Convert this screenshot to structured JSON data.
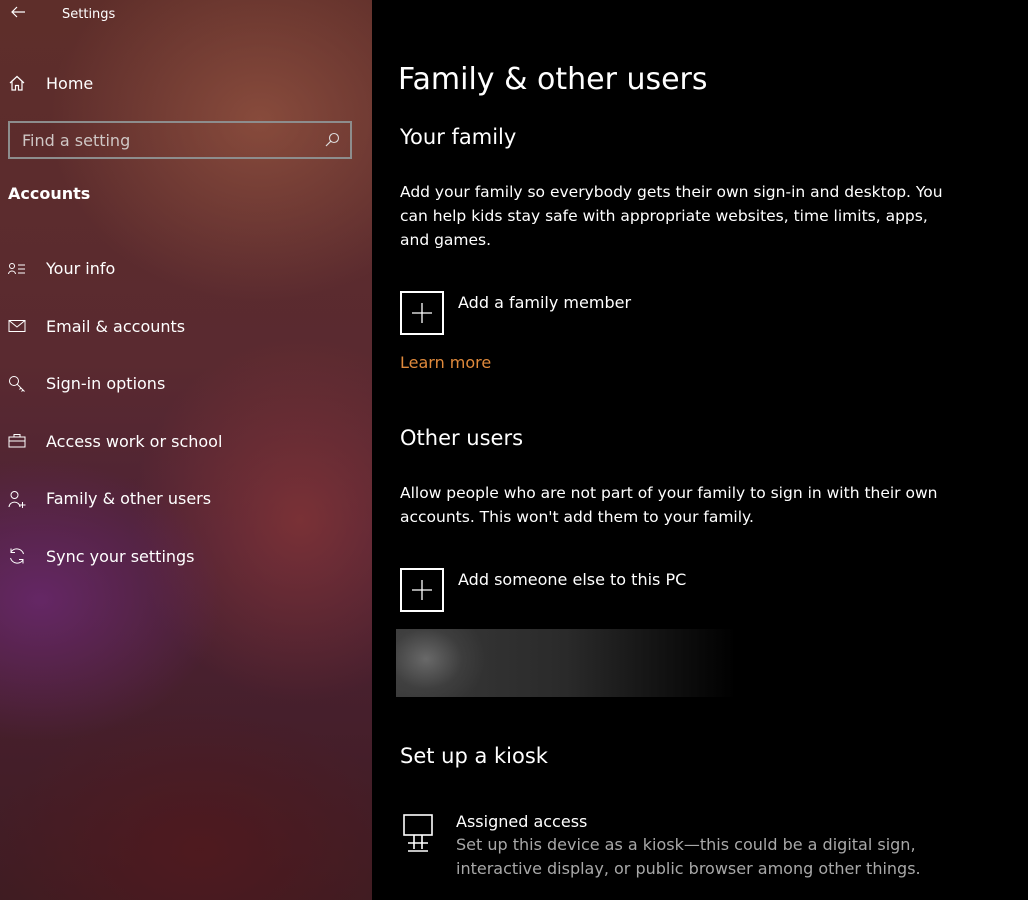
{
  "window": {
    "title": "Settings"
  },
  "sidebar": {
    "home_label": "Home",
    "search_placeholder": "Find a setting",
    "section": "Accounts",
    "items": [
      {
        "label": "Your info",
        "icon": "contact-info-icon"
      },
      {
        "label": "Email & accounts",
        "icon": "mail-icon"
      },
      {
        "label": "Sign-in options",
        "icon": "key-icon"
      },
      {
        "label": "Access work or school",
        "icon": "briefcase-icon"
      },
      {
        "label": "Family & other users",
        "icon": "add-person-icon"
      },
      {
        "label": "Sync your settings",
        "icon": "sync-icon"
      }
    ]
  },
  "main": {
    "title": "Family & other users",
    "family": {
      "heading": "Your family",
      "description": "Add your family so everybody gets their own sign-in and desktop. You can help kids stay safe with appropriate websites, time limits, apps, and games.",
      "add_label": "Add a family member",
      "learn_more": "Learn more"
    },
    "other_users": {
      "heading": "Other users",
      "description": "Allow people who are not part of your family to sign in with their own accounts. This won't add them to your family.",
      "add_label": "Add someone else to this PC"
    },
    "kiosk": {
      "heading": "Set up a kiosk",
      "title": "Assigned access",
      "description": "Set up this device as a kiosk—this could be a digital sign, interactive display, or public browser among other things."
    }
  },
  "colors": {
    "accent_link": "#e08a3c",
    "background": "#000000",
    "secondary_text": "#a8a8a8"
  }
}
